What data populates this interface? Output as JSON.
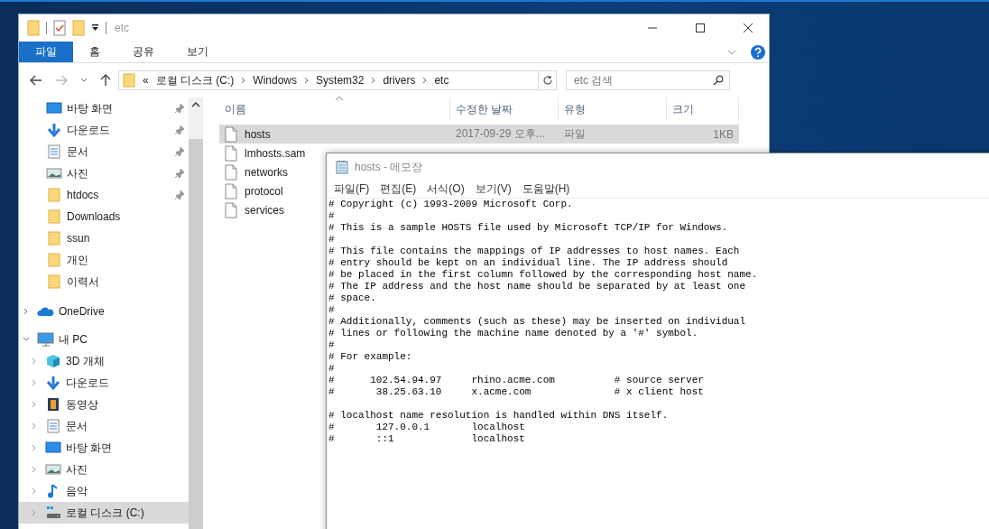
{
  "explorer": {
    "title": "etc",
    "ribbon_tabs": [
      {
        "label": "파일",
        "selected": true
      },
      {
        "label": "홈",
        "selected": false
      },
      {
        "label": "공유",
        "selected": false
      },
      {
        "label": "보기",
        "selected": false
      }
    ],
    "address": {
      "overflow": "«",
      "crumbs": [
        "로컬 디스크 (C:)",
        "Windows",
        "System32",
        "drivers",
        "etc"
      ]
    },
    "search": {
      "placeholder": "etc 검색"
    },
    "quick_access": [
      {
        "label": "바탕 화면",
        "kind": "desktop",
        "pinned": true,
        "selected": false
      },
      {
        "label": "다운로드",
        "kind": "download",
        "pinned": true,
        "selected": false
      },
      {
        "label": "문서",
        "kind": "document",
        "pinned": true,
        "selected": false
      },
      {
        "label": "사진",
        "kind": "pictures",
        "pinned": true,
        "selected": false
      },
      {
        "label": "htdocs",
        "kind": "folder",
        "pinned": true,
        "selected": false
      },
      {
        "label": "Downloads",
        "kind": "folder",
        "pinned": false,
        "selected": false
      },
      {
        "label": "ssun",
        "kind": "folder",
        "pinned": false,
        "selected": false
      },
      {
        "label": "개인",
        "kind": "folder",
        "pinned": false,
        "selected": false
      },
      {
        "label": "이력서",
        "kind": "folder",
        "pinned": false,
        "selected": false
      }
    ],
    "nav_roots": [
      {
        "label": "OneDrive",
        "kind": "cloud",
        "expanded": false,
        "selected": false
      },
      {
        "label": "내 PC",
        "kind": "pc",
        "expanded": true,
        "selected": false,
        "children": [
          {
            "label": "3D 개체",
            "kind": "cube",
            "expanded": false,
            "selected": false
          },
          {
            "label": "다운로드",
            "kind": "download",
            "expanded": false,
            "selected": false
          },
          {
            "label": "동영상",
            "kind": "video",
            "expanded": false,
            "selected": false
          },
          {
            "label": "문서",
            "kind": "document",
            "expanded": false,
            "selected": false
          },
          {
            "label": "바탕 화면",
            "kind": "desktop",
            "expanded": false,
            "selected": false
          },
          {
            "label": "사진",
            "kind": "pictures",
            "expanded": false,
            "selected": false
          },
          {
            "label": "음악",
            "kind": "music",
            "expanded": false,
            "selected": false
          },
          {
            "label": "로컬 디스크 (C:)",
            "kind": "drive",
            "expanded": false,
            "selected": true
          }
        ]
      }
    ],
    "columns": [
      {
        "label": "이름",
        "sorted": true
      },
      {
        "label": "수정한 날짜",
        "sorted": false
      },
      {
        "label": "유형",
        "sorted": false
      },
      {
        "label": "크기",
        "sorted": false
      }
    ],
    "files": [
      {
        "name": "hosts",
        "date": "2017-09-29 오후...",
        "type": "파일",
        "size": "1KB",
        "selected": true
      },
      {
        "name": "lmhosts.sam",
        "selected": false
      },
      {
        "name": "networks",
        "selected": false
      },
      {
        "name": "protocol",
        "selected": false
      },
      {
        "name": "services",
        "selected": false
      }
    ]
  },
  "notepad": {
    "title": "hosts - 메모장",
    "menu": [
      "파일(F)",
      "편집(E)",
      "서식(O)",
      "보기(V)",
      "도움말(H)"
    ],
    "content": "# Copyright (c) 1993-2009 Microsoft Corp.\n#\n# This is a sample HOSTS file used by Microsoft TCP/IP for Windows.\n#\n# This file contains the mappings of IP addresses to host names. Each\n# entry should be kept on an individual line. The IP address should\n# be placed in the first column followed by the corresponding host name.\n# The IP address and the host name should be separated by at least one\n# space.\n#\n# Additionally, comments (such as these) may be inserted on individual\n# lines or following the machine name denoted by a '#' symbol.\n#\n# For example:\n#\n#      102.54.94.97     rhino.acme.com          # source server\n#       38.25.63.10     x.acme.com              # x client host\n\n# localhost name resolution is handled within DNS itself.\n#\t127.0.0.1       localhost\n#\t::1             localhost"
  }
}
